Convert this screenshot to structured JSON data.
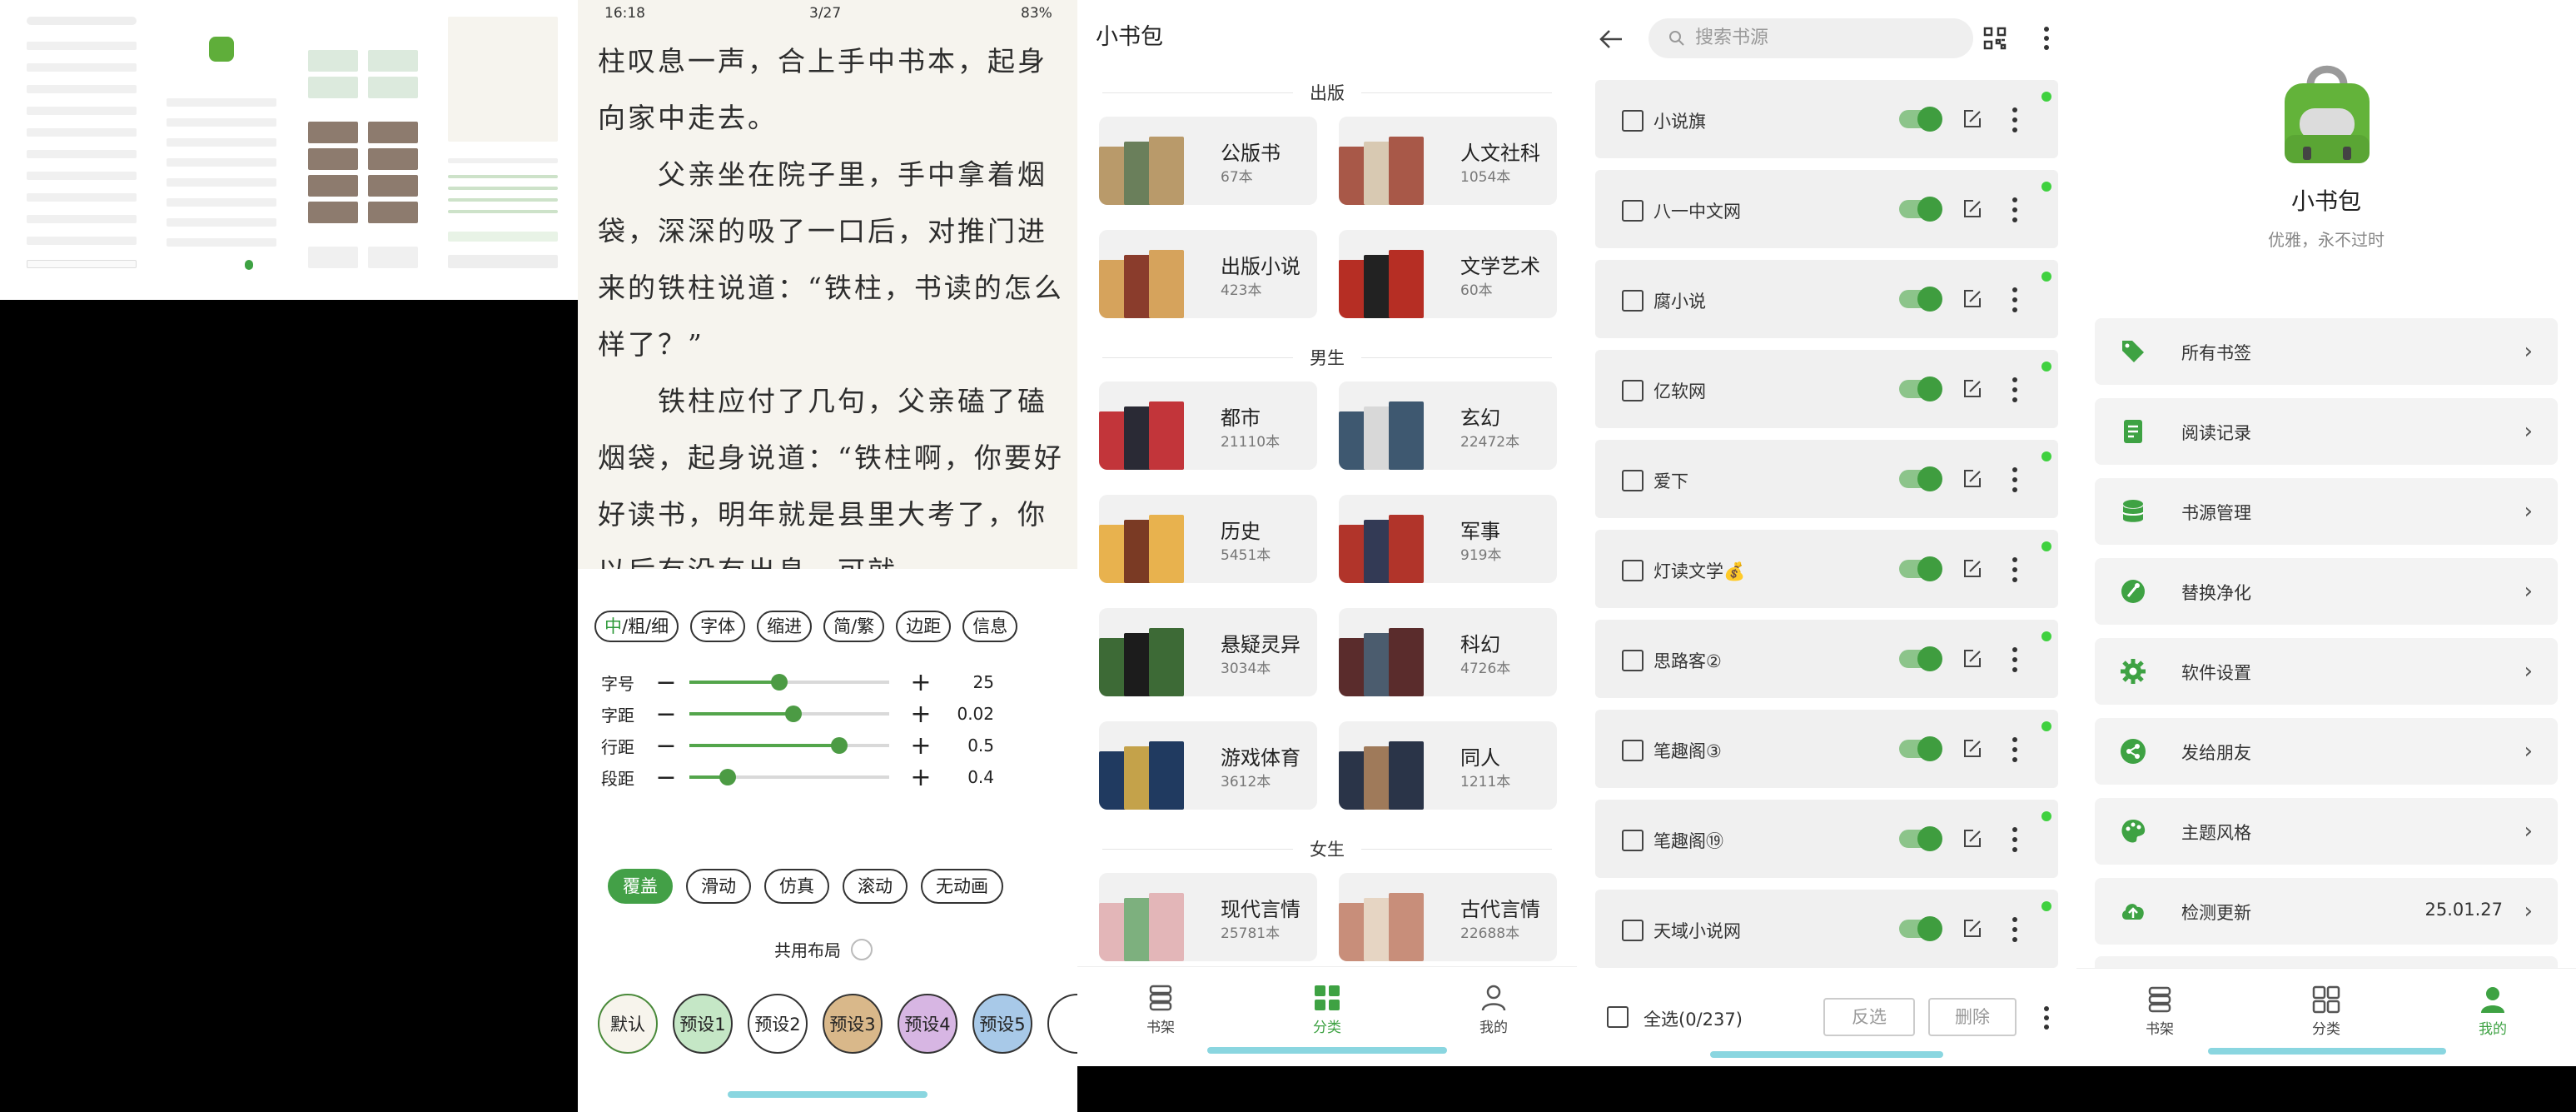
{
  "reader": {
    "status_time": "16:18",
    "status_page": "3/27",
    "status_battery": "83%",
    "paragraphs": [
      "柱叹息一声，合上手中书本，起身向家中走去。",
      "　　父亲坐在院子里，手中拿着烟袋，深深的吸了一口后，对推门进来的铁柱说道：“铁柱，书读的怎么样了？”",
      "　　铁柱应付了几句，父亲磕了磕烟袋，起身说道：“铁柱啊，你要好好读书，明年就是县里大考了，你以后有没有出息，可就"
    ],
    "font_chip": {
      "active": "中",
      "rest": "/粗/细"
    },
    "chips": [
      "字体",
      "缩进",
      "简/繁",
      "边距",
      "信息"
    ],
    "sliders": [
      {
        "label": "字号",
        "value": "25",
        "level": 0.45
      },
      {
        "label": "字距",
        "value": "0.02",
        "level": 0.52
      },
      {
        "label": "行距",
        "value": "0.5",
        "level": 0.75
      },
      {
        "label": "段距",
        "value": "0.4",
        "level": 0.19
      }
    ],
    "animations": [
      "覆盖",
      "滑动",
      "仿真",
      "滚动",
      "无动画"
    ],
    "shared_layout": "共用布局",
    "presets": [
      {
        "label": "默认",
        "color": "#f7f4ec",
        "border": "#4a8a3a"
      },
      {
        "label": "预设1",
        "color": "#c5e7c6",
        "border": "#333333"
      },
      {
        "label": "预设2",
        "color": "#ffffff",
        "border": "#333333"
      },
      {
        "label": "预设3",
        "color": "#d9b88a",
        "border": "#333333"
      },
      {
        "label": "预设4",
        "color": "#d7b6e3",
        "border": "#333333"
      },
      {
        "label": "预设5",
        "color": "#a8c9e8",
        "border": "#333333"
      }
    ]
  },
  "category": {
    "title": "小书包",
    "sections": [
      {
        "name": "出版",
        "cards": [
          {
            "name": "公版书",
            "count": "67本",
            "c1": "#b99a6a",
            "c2": "#6a7f5b"
          },
          {
            "name": "人文社科",
            "count": "1054本",
            "c1": "#a85848",
            "c2": "#d8c9b2"
          },
          {
            "name": "出版小说",
            "count": "423本",
            "c1": "#d6a35c",
            "c2": "#8a3c2c"
          },
          {
            "name": "文学艺术",
            "count": "60本",
            "c1": "#b62e24",
            "c2": "#222222"
          }
        ]
      },
      {
        "name": "男生",
        "cards": [
          {
            "name": "都市",
            "count": "21110本",
            "c1": "#c2353a",
            "c2": "#2a2a35"
          },
          {
            "name": "玄幻",
            "count": "22472本",
            "c1": "#3e5870",
            "c2": "#d8d8d8"
          },
          {
            "name": "历史",
            "count": "5451本",
            "c1": "#e8b24e",
            "c2": "#7a3a24"
          },
          {
            "name": "军事",
            "count": "919本",
            "c1": "#b1342a",
            "c2": "#333a55"
          },
          {
            "name": "悬疑灵异",
            "count": "3034本",
            "c1": "#3d6a36",
            "c2": "#1c1c1c"
          },
          {
            "name": "科幻",
            "count": "4726本",
            "c1": "#5a2c2c",
            "c2": "#4b5c6e"
          },
          {
            "name": "游戏体育",
            "count": "3612本",
            "c1": "#203a60",
            "c2": "#c4a24a"
          },
          {
            "name": "同人",
            "count": "1211本",
            "c1": "#2a3448",
            "c2": "#9f7a5a"
          }
        ]
      },
      {
        "name": "女生",
        "cards": [
          {
            "name": "现代言情",
            "count": "25781本",
            "c1": "#e3b6b8",
            "c2": "#7db07e"
          },
          {
            "name": "古代言情",
            "count": "22688本",
            "c1": "#c88e7a",
            "c2": "#e6d5c3"
          }
        ]
      }
    ],
    "nav": [
      {
        "label": "书架",
        "icon": "bookshelf-icon"
      },
      {
        "label": "分类",
        "icon": "category-grid-icon"
      },
      {
        "label": "我的",
        "icon": "person-icon"
      }
    ],
    "active_nav": 1
  },
  "sources": {
    "search_placeholder": "搜索书源",
    "items": [
      {
        "name": "小说旗",
        "dot": true
      },
      {
        "name": "八一中文网",
        "dot": true
      },
      {
        "name": "腐小说",
        "dot": true
      },
      {
        "name": "亿软网",
        "dot": true
      },
      {
        "name": "爱下",
        "dot": true
      },
      {
        "name": "灯读文学💰",
        "dot": true
      },
      {
        "name": "思路客②",
        "dot": true
      },
      {
        "name": "笔趣阁③",
        "dot": true
      },
      {
        "name": "笔趣阁⑲",
        "dot": true
      },
      {
        "name": "天域小说网",
        "dot": true
      }
    ],
    "select_all": "全选(0/237)",
    "invert": "反选",
    "delete": "删除"
  },
  "mine": {
    "app_name": "小书包",
    "slogan": "优雅，永不过时",
    "menu": [
      {
        "label": "所有书签",
        "icon": "tag-icon",
        "value": ""
      },
      {
        "label": "阅读记录",
        "icon": "record-icon",
        "value": ""
      },
      {
        "label": "书源管理",
        "icon": "database-icon",
        "value": ""
      },
      {
        "label": "替换净化",
        "icon": "clean-icon",
        "value": ""
      },
      {
        "label": "软件设置",
        "icon": "gear-icon",
        "value": ""
      },
      {
        "label": "发给朋友",
        "icon": "share-icon",
        "value": ""
      },
      {
        "label": "主题风格",
        "icon": "palette-icon",
        "value": ""
      },
      {
        "label": "检测更新",
        "icon": "cloud-upload-icon",
        "value": "25.01.27"
      }
    ],
    "nav": [
      {
        "label": "书架",
        "icon": "bookshelf-icon"
      },
      {
        "label": "分类",
        "icon": "category-grid-icon"
      },
      {
        "label": "我的",
        "icon": "person-icon"
      }
    ],
    "active_nav": 2
  },
  "colors": {
    "accent": "#3ea243",
    "toggle_on": "#3f9d3f",
    "status_dot": "#3fd13f",
    "home_indicator": "#8ad6e0"
  }
}
